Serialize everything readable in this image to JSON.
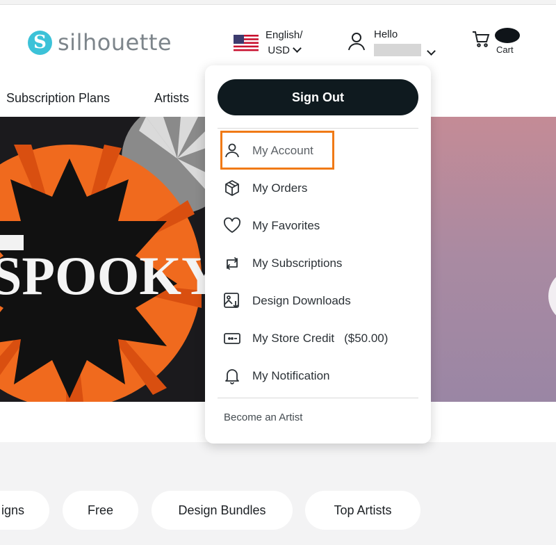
{
  "header": {
    "logo_letter": "S",
    "logo_text": "silhouette",
    "language": "English/",
    "currency": "USD",
    "greeting": "Hello",
    "cart_label": "Cart"
  },
  "nav": {
    "items": [
      "Subscription Plans",
      "Artists"
    ]
  },
  "hero": {
    "image_text": "SPOOKY"
  },
  "dropdown": {
    "sign_out": "Sign Out",
    "items": [
      {
        "label": "My Account",
        "icon": "user-icon"
      },
      {
        "label": "My Orders",
        "icon": "box-icon"
      },
      {
        "label": "My Favorites",
        "icon": "heart-icon"
      },
      {
        "label": "My Subscriptions",
        "icon": "repeat-icon"
      },
      {
        "label": "Design Downloads",
        "icon": "image-download-icon"
      },
      {
        "label": "My Store Credit",
        "icon": "credit-card-icon",
        "amount": "($50.00)"
      },
      {
        "label": "My Notification",
        "icon": "bell-icon"
      }
    ],
    "become_artist": "Become an Artist"
  },
  "chips": [
    "igns",
    "Free",
    "Design Bundles",
    "Top Artists"
  ],
  "colors": {
    "accent_highlight": "#f07a16",
    "logo_teal": "#3cc2d8",
    "button_dark": "#0f1a1f"
  }
}
